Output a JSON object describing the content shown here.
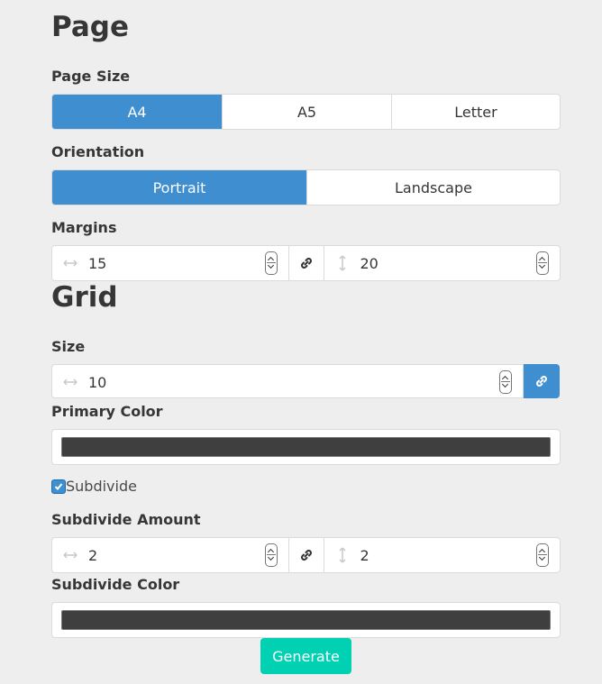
{
  "page": {
    "heading": "Page",
    "page_size": {
      "label": "Page Size",
      "options": [
        "A4",
        "A5",
        "Letter"
      ],
      "selected": "A4"
    },
    "orientation": {
      "label": "Orientation",
      "options": [
        "Portrait",
        "Landscape"
      ],
      "selected": "Portrait"
    },
    "margins": {
      "label": "Margins",
      "horizontal": "15",
      "vertical": "20",
      "horizontal_icon": "arrows-horizontal-icon",
      "vertical_icon": "arrows-vertical-icon",
      "link_icon": "link-icon"
    }
  },
  "grid": {
    "heading": "Grid",
    "size": {
      "label": "Size",
      "value": "10",
      "icon": "arrows-horizontal-icon",
      "link_icon": "link-icon"
    },
    "primary_color": {
      "label": "Primary Color",
      "value": "#3f3f3f"
    },
    "subdivide": {
      "label": "Subdivide",
      "checked": true
    },
    "subdivide_amount": {
      "label": "Subdivide Amount",
      "horizontal": "2",
      "vertical": "2"
    },
    "subdivide_color": {
      "label": "Subdivide Color",
      "value": "#3f3f3f"
    }
  },
  "generate_label": "Generate",
  "colors": {
    "accent": "#3e8ed0",
    "generate": "#00d1b2",
    "background": "#eeeeee"
  }
}
